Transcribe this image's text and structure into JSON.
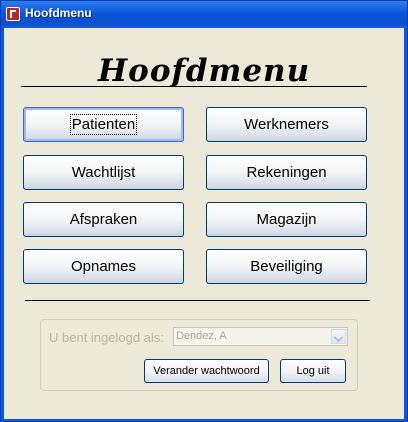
{
  "window": {
    "title": "Hoofdmenu"
  },
  "heading": "Hoofdmenu",
  "menu_buttons": {
    "patienten": "Patienten",
    "werknemers": "Werknemers",
    "wachtlijst": "Wachtlijst",
    "rekeningen": "Rekeningen",
    "afspraken": "Afspraken",
    "magazijn": "Magazijn",
    "opnames": "Opnames",
    "beveiliging": "Beveiliging"
  },
  "login": {
    "label": "U bent ingelogd als:",
    "user_value": "Dendez, A",
    "change_password_button": "Verander wachtwoord",
    "logout_button": "Log uit"
  }
}
